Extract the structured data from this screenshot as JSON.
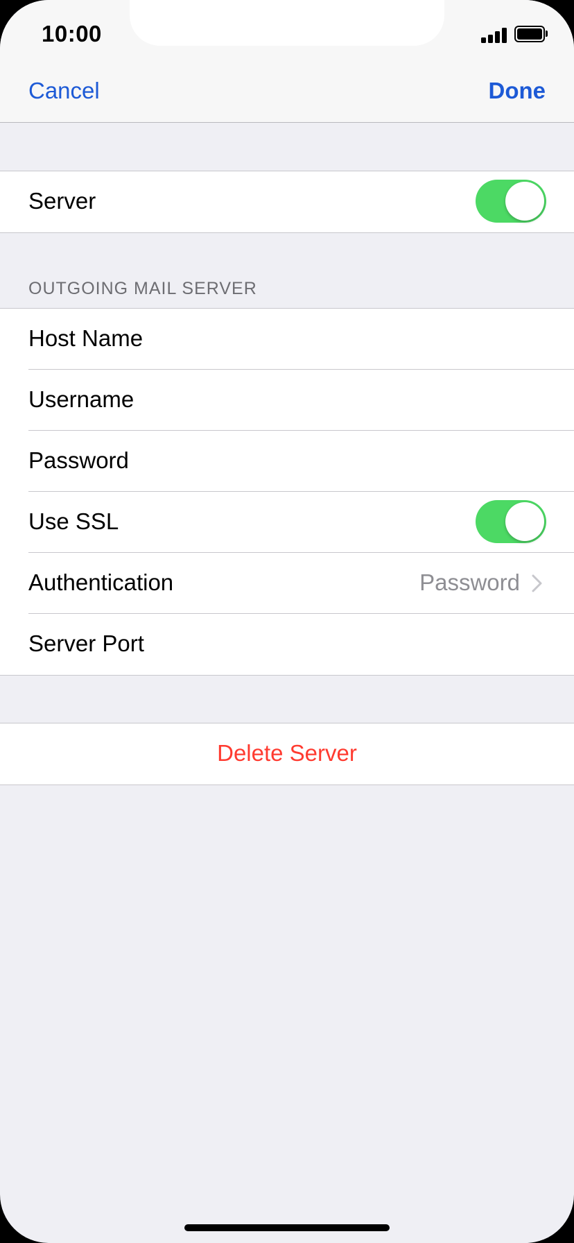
{
  "status_bar": {
    "time": "10:00"
  },
  "nav": {
    "cancel_label": "Cancel",
    "done_label": "Done"
  },
  "server_section": {
    "label": "Server",
    "enabled": true
  },
  "outgoing": {
    "header": "OUTGOING MAIL SERVER",
    "host_name_label": "Host Name",
    "username_label": "Username",
    "password_label": "Password",
    "use_ssl_label": "Use SSL",
    "use_ssl_enabled": true,
    "authentication_label": "Authentication",
    "authentication_value": "Password",
    "server_port_label": "Server Port"
  },
  "delete": {
    "label": "Delete Server"
  },
  "colors": {
    "accent": "#1d5ad6",
    "toggle_on": "#4cd964",
    "destructive": "#ff3b30",
    "background": "#efeff4"
  },
  "icons": {
    "signal": "cellular-signal-icon",
    "battery": "battery-icon",
    "chevron": "chevron-right-icon"
  }
}
